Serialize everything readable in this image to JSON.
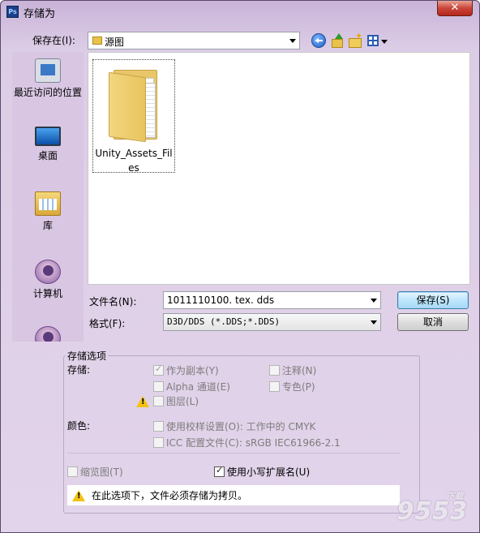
{
  "window": {
    "title": "存储为",
    "app_icon": "Ps",
    "close_label": "✕"
  },
  "save_in": {
    "label": "保存在(I):",
    "current": "源图"
  },
  "places": [
    {
      "label": "最近访问的位置"
    },
    {
      "label": "桌面"
    },
    {
      "label": "库"
    },
    {
      "label": "计算机"
    }
  ],
  "files": [
    {
      "name": "Unity_Assets_Files"
    }
  ],
  "filename": {
    "label": "文件名(N):",
    "value": "1011110100. tex. dds"
  },
  "format": {
    "label": "格式(F):",
    "value": "D3D/DDS (*.DDS;*.DDS)"
  },
  "buttons": {
    "save": "保存(S)",
    "cancel": "取消"
  },
  "options": {
    "group_title": "存储选项",
    "storage_label": "存储:",
    "as_copy": "作为副本(Y)",
    "alpha": "Alpha 通道(E)",
    "layers": "图层(L)",
    "notes": "注释(N)",
    "spot": "专色(P)",
    "color_label": "颜色:",
    "proof": "使用校样设置(O): 工作中的 CMYK",
    "icc": "ICC 配置文件(C): sRGB IEC61966-2.1",
    "thumbnail": "缩览图(T)",
    "lowercase": "使用小写扩展名(U)",
    "notice": "在此选项下，文件必须存储为拷贝。"
  },
  "watermark": {
    "text": "9553",
    "sub": "下载"
  },
  "colors": {
    "accent": "#3c7fb1",
    "warning": "#f3c211"
  }
}
